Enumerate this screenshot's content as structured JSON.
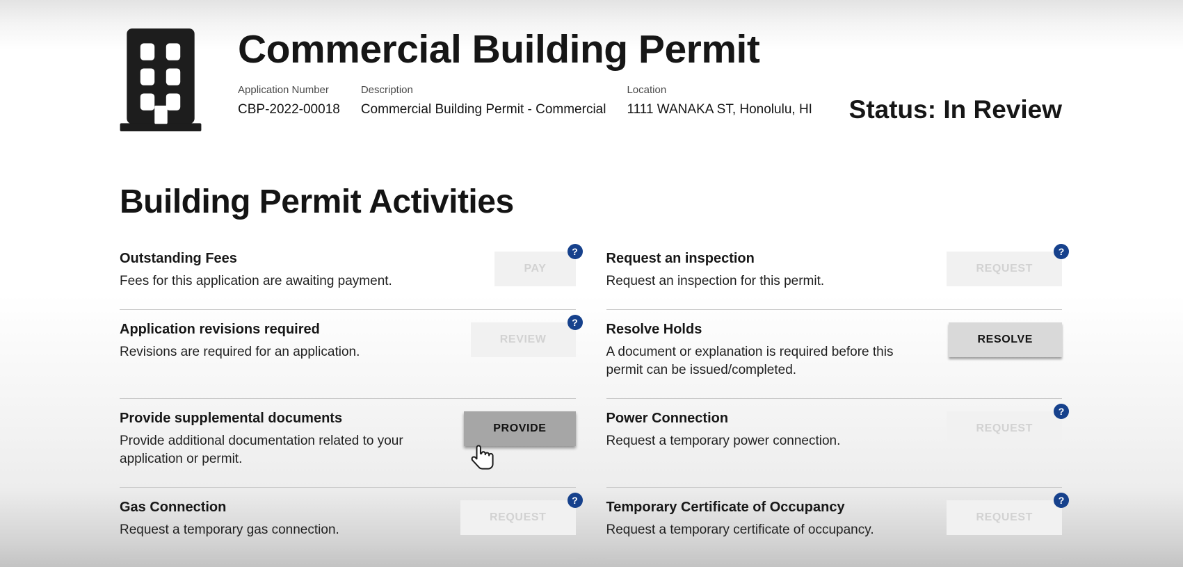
{
  "header": {
    "title": "Commercial Building Permit",
    "status": "Status: In Review",
    "meta": [
      {
        "label": "Application Number",
        "value": "CBP-2022-00018"
      },
      {
        "label": "Description",
        "value": "Commercial Building Permit - Commercial"
      },
      {
        "label": "Location",
        "value": "1111 WANAKA ST, Honolulu, HI"
      }
    ]
  },
  "section": {
    "title": "Building Permit Activities"
  },
  "activities": [
    {
      "title": "Outstanding Fees",
      "description": "Fees for this application are awaiting payment.",
      "button_label": "PAY",
      "state": "disabled",
      "help": true
    },
    {
      "title": "Request an inspection",
      "description": "Request an inspection for this permit.",
      "button_label": "REQUEST",
      "state": "disabled",
      "help": true
    },
    {
      "title": "Application revisions required",
      "description": "Revisions are required for an application.",
      "button_label": "REVIEW",
      "state": "disabled",
      "help": true
    },
    {
      "title": "Resolve Holds",
      "description": "A document or explanation is required before this permit can be issued/completed.",
      "button_label": "RESOLVE",
      "state": "enabled",
      "help": false
    },
    {
      "title": "Provide supplemental documents",
      "description": "Provide additional documentation related to your application or permit.",
      "button_label": "PROVIDE",
      "state": "hover",
      "help": false
    },
    {
      "title": "Power Connection",
      "description": "Request a temporary power connection.",
      "button_label": "REQUEST",
      "state": "disabled",
      "help": true
    },
    {
      "title": "Gas Connection",
      "description": "Request a temporary gas connection.",
      "button_label": "REQUEST",
      "state": "disabled",
      "help": true
    },
    {
      "title": "Temporary Certificate of Occupancy",
      "description": "Request a temporary certificate of occupancy.",
      "button_label": "REQUEST",
      "state": "disabled",
      "help": true
    }
  ],
  "help_badge_glyph": "?",
  "icons": {
    "building": "building-icon",
    "help": "question-mark-icon",
    "cursor": "hand-pointer-cursor"
  },
  "colors": {
    "help_badge_bg": "#16418c",
    "disabled_button_bg": "#f1f1f1",
    "disabled_button_text": "#d2d2d2",
    "enabled_button_bg": "#d9d9d9",
    "hover_button_bg": "#a6a6a6",
    "divider": "#cbcbcb"
  }
}
